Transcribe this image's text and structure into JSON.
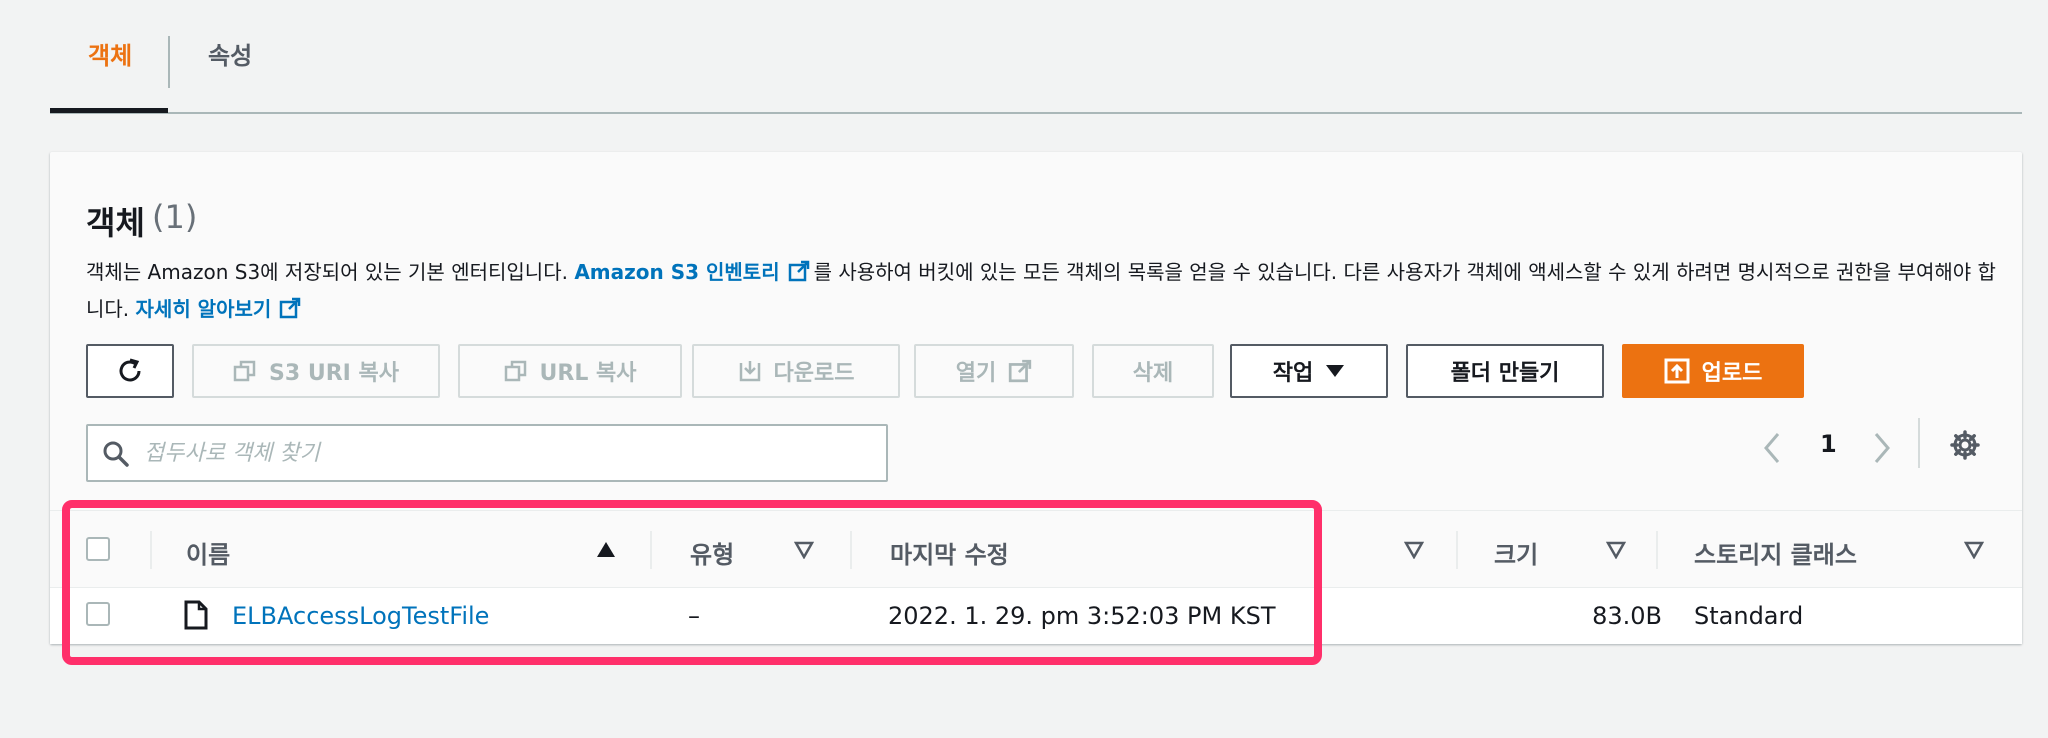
{
  "tabs": [
    {
      "label": "객체",
      "active": true
    },
    {
      "label": "속성",
      "active": false
    }
  ],
  "panel": {
    "title": "객체",
    "count": "(1)",
    "description": {
      "part1": "객체는 Amazon S3에 저장되어 있는 기본 엔터티입니다. ",
      "link1": "Amazon S3 인벤토리",
      "part2": "를 사용하여 버킷에 있는 모든 객체의 목록을 얻을 수 있습니다. 다른 사용자가 객체에 액세스할 수 있게 하려면 명시적으로 권한을 부여해야 합니다. ",
      "link2": "자세히 알아보기"
    }
  },
  "toolbar": {
    "refresh_icon": "refresh-icon",
    "copy_s3_uri": "S3 URI 복사",
    "copy_url": "URL 복사",
    "download": "다운로드",
    "open": "열기",
    "delete": "삭제",
    "actions": "작업",
    "create_folder": "폴더 만들기",
    "upload": "업로드"
  },
  "search": {
    "placeholder": "접두사로 객체 찾기"
  },
  "pagination": {
    "current_page": "1"
  },
  "table": {
    "columns": {
      "name": "이름",
      "type": "유형",
      "last_modified": "마지막 수정",
      "size": "크기",
      "storage_class": "스토리지 클래스"
    },
    "rows": [
      {
        "name": "ELBAccessLogTestFile",
        "type": "–",
        "last_modified": "2022. 1. 29. pm 3:52:03 PM KST",
        "size": "83.0B",
        "storage_class": "Standard"
      }
    ]
  },
  "colors": {
    "accent": "#ec7211",
    "link": "#0073bb",
    "highlight": "#ff2f6a"
  }
}
